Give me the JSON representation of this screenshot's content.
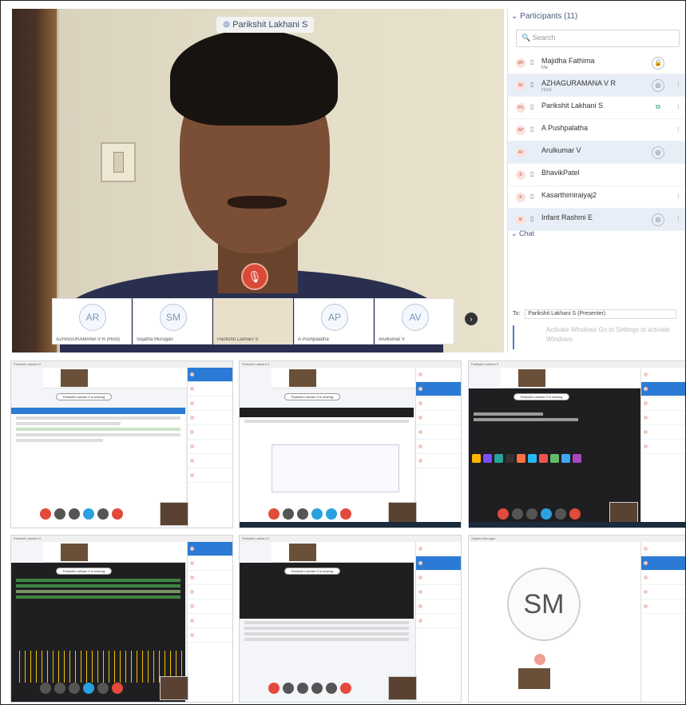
{
  "meeting": {
    "speaker_label": "Parikshit Lakhani S",
    "thumbnails": [
      {
        "initials": "AR",
        "name": "AZHAGURAMANA V R (Host)"
      },
      {
        "initials": "SM",
        "name": "Sujatha Murugan"
      },
      {
        "initials": "",
        "name": "Parikshit Lakhani S"
      },
      {
        "initials": "AP",
        "name": "A Pushpalatha"
      },
      {
        "initials": "AV",
        "name": "Arulkumar V"
      }
    ],
    "participants_header": "Participants (11)",
    "search_placeholder": "Search",
    "participants": [
      {
        "initials": "MF",
        "name": "Majidha Fathima",
        "sub": "Me",
        "selected": false
      },
      {
        "initials": "AV",
        "name": "AZHAGURAMANA V R",
        "sub": "Host",
        "selected": true
      },
      {
        "initials": "PS",
        "name": "Parikshit Lakhani S",
        "sub": "",
        "selected": false
      },
      {
        "initials": "AP",
        "name": "A Pushpalatha",
        "sub": "",
        "selected": false
      },
      {
        "initials": "AV",
        "name": "Arulkumar V",
        "sub": "",
        "selected": true
      },
      {
        "initials": "B",
        "name": "BhavikPatel",
        "sub": "",
        "selected": false
      },
      {
        "initials": "K",
        "name": "Kasarthimiraiyaj2",
        "sub": "",
        "selected": false
      },
      {
        "initials": "IE",
        "name": "Infant Rashmi E",
        "sub": "",
        "selected": true
      }
    ],
    "chat_header": "Chat",
    "chat_to_label": "To:",
    "chat_to_value": "Parikshit Lakhani S (Presenter)",
    "chat_placeholder": "Activate Windows Go to Settings to activate Windows."
  },
  "shares": [
    {
      "title": "Parikshit Lakhani S",
      "pill": "Parikshit Lakhani S is sharing"
    },
    {
      "title": "Parikshit Lakhani S",
      "pill": "Parikshit Lakhani S is sharing"
    },
    {
      "title": "Parikshit Lakhani S",
      "pill": "Parikshit Lakhani S is sharing"
    },
    {
      "title": "Parikshit Lakhani S",
      "pill": "Parikshit Lakhani S is sharing"
    },
    {
      "title": "Parikshit Lakhani S",
      "pill": "Parikshit Lakhani S is sharing"
    },
    {
      "title": "Sujatha Murugan",
      "pill": "",
      "avatar": "SM"
    }
  ],
  "colors": {
    "accent": "#2b7bd6",
    "mute_red": "#e24a3b",
    "host_highlight": "#e7eef8"
  }
}
